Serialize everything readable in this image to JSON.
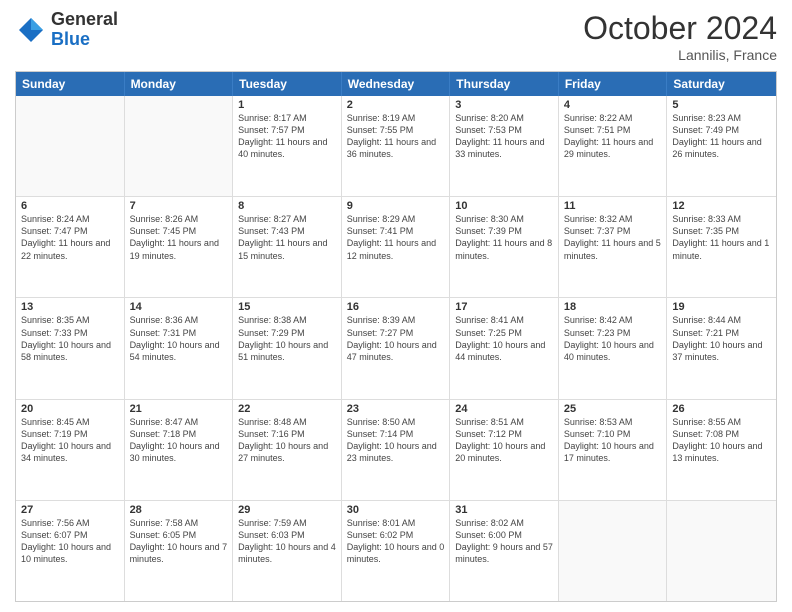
{
  "header": {
    "logo_general": "General",
    "logo_blue": "Blue",
    "month_title": "October 2024",
    "location": "Lannilis, France"
  },
  "days_of_week": [
    "Sunday",
    "Monday",
    "Tuesday",
    "Wednesday",
    "Thursday",
    "Friday",
    "Saturday"
  ],
  "weeks": [
    [
      {
        "day": "",
        "sunrise": "",
        "sunset": "",
        "daylight": "",
        "empty": true
      },
      {
        "day": "",
        "sunrise": "",
        "sunset": "",
        "daylight": "",
        "empty": true
      },
      {
        "day": "1",
        "sunrise": "Sunrise: 8:17 AM",
        "sunset": "Sunset: 7:57 PM",
        "daylight": "Daylight: 11 hours and 40 minutes.",
        "empty": false
      },
      {
        "day": "2",
        "sunrise": "Sunrise: 8:19 AM",
        "sunset": "Sunset: 7:55 PM",
        "daylight": "Daylight: 11 hours and 36 minutes.",
        "empty": false
      },
      {
        "day": "3",
        "sunrise": "Sunrise: 8:20 AM",
        "sunset": "Sunset: 7:53 PM",
        "daylight": "Daylight: 11 hours and 33 minutes.",
        "empty": false
      },
      {
        "day": "4",
        "sunrise": "Sunrise: 8:22 AM",
        "sunset": "Sunset: 7:51 PM",
        "daylight": "Daylight: 11 hours and 29 minutes.",
        "empty": false
      },
      {
        "day": "5",
        "sunrise": "Sunrise: 8:23 AM",
        "sunset": "Sunset: 7:49 PM",
        "daylight": "Daylight: 11 hours and 26 minutes.",
        "empty": false
      }
    ],
    [
      {
        "day": "6",
        "sunrise": "Sunrise: 8:24 AM",
        "sunset": "Sunset: 7:47 PM",
        "daylight": "Daylight: 11 hours and 22 minutes.",
        "empty": false
      },
      {
        "day": "7",
        "sunrise": "Sunrise: 8:26 AM",
        "sunset": "Sunset: 7:45 PM",
        "daylight": "Daylight: 11 hours and 19 minutes.",
        "empty": false
      },
      {
        "day": "8",
        "sunrise": "Sunrise: 8:27 AM",
        "sunset": "Sunset: 7:43 PM",
        "daylight": "Daylight: 11 hours and 15 minutes.",
        "empty": false
      },
      {
        "day": "9",
        "sunrise": "Sunrise: 8:29 AM",
        "sunset": "Sunset: 7:41 PM",
        "daylight": "Daylight: 11 hours and 12 minutes.",
        "empty": false
      },
      {
        "day": "10",
        "sunrise": "Sunrise: 8:30 AM",
        "sunset": "Sunset: 7:39 PM",
        "daylight": "Daylight: 11 hours and 8 minutes.",
        "empty": false
      },
      {
        "day": "11",
        "sunrise": "Sunrise: 8:32 AM",
        "sunset": "Sunset: 7:37 PM",
        "daylight": "Daylight: 11 hours and 5 minutes.",
        "empty": false
      },
      {
        "day": "12",
        "sunrise": "Sunrise: 8:33 AM",
        "sunset": "Sunset: 7:35 PM",
        "daylight": "Daylight: 11 hours and 1 minute.",
        "empty": false
      }
    ],
    [
      {
        "day": "13",
        "sunrise": "Sunrise: 8:35 AM",
        "sunset": "Sunset: 7:33 PM",
        "daylight": "Daylight: 10 hours and 58 minutes.",
        "empty": false
      },
      {
        "day": "14",
        "sunrise": "Sunrise: 8:36 AM",
        "sunset": "Sunset: 7:31 PM",
        "daylight": "Daylight: 10 hours and 54 minutes.",
        "empty": false
      },
      {
        "day": "15",
        "sunrise": "Sunrise: 8:38 AM",
        "sunset": "Sunset: 7:29 PM",
        "daylight": "Daylight: 10 hours and 51 minutes.",
        "empty": false
      },
      {
        "day": "16",
        "sunrise": "Sunrise: 8:39 AM",
        "sunset": "Sunset: 7:27 PM",
        "daylight": "Daylight: 10 hours and 47 minutes.",
        "empty": false
      },
      {
        "day": "17",
        "sunrise": "Sunrise: 8:41 AM",
        "sunset": "Sunset: 7:25 PM",
        "daylight": "Daylight: 10 hours and 44 minutes.",
        "empty": false
      },
      {
        "day": "18",
        "sunrise": "Sunrise: 8:42 AM",
        "sunset": "Sunset: 7:23 PM",
        "daylight": "Daylight: 10 hours and 40 minutes.",
        "empty": false
      },
      {
        "day": "19",
        "sunrise": "Sunrise: 8:44 AM",
        "sunset": "Sunset: 7:21 PM",
        "daylight": "Daylight: 10 hours and 37 minutes.",
        "empty": false
      }
    ],
    [
      {
        "day": "20",
        "sunrise": "Sunrise: 8:45 AM",
        "sunset": "Sunset: 7:19 PM",
        "daylight": "Daylight: 10 hours and 34 minutes.",
        "empty": false
      },
      {
        "day": "21",
        "sunrise": "Sunrise: 8:47 AM",
        "sunset": "Sunset: 7:18 PM",
        "daylight": "Daylight: 10 hours and 30 minutes.",
        "empty": false
      },
      {
        "day": "22",
        "sunrise": "Sunrise: 8:48 AM",
        "sunset": "Sunset: 7:16 PM",
        "daylight": "Daylight: 10 hours and 27 minutes.",
        "empty": false
      },
      {
        "day": "23",
        "sunrise": "Sunrise: 8:50 AM",
        "sunset": "Sunset: 7:14 PM",
        "daylight": "Daylight: 10 hours and 23 minutes.",
        "empty": false
      },
      {
        "day": "24",
        "sunrise": "Sunrise: 8:51 AM",
        "sunset": "Sunset: 7:12 PM",
        "daylight": "Daylight: 10 hours and 20 minutes.",
        "empty": false
      },
      {
        "day": "25",
        "sunrise": "Sunrise: 8:53 AM",
        "sunset": "Sunset: 7:10 PM",
        "daylight": "Daylight: 10 hours and 17 minutes.",
        "empty": false
      },
      {
        "day": "26",
        "sunrise": "Sunrise: 8:55 AM",
        "sunset": "Sunset: 7:08 PM",
        "daylight": "Daylight: 10 hours and 13 minutes.",
        "empty": false
      }
    ],
    [
      {
        "day": "27",
        "sunrise": "Sunrise: 7:56 AM",
        "sunset": "Sunset: 6:07 PM",
        "daylight": "Daylight: 10 hours and 10 minutes.",
        "empty": false
      },
      {
        "day": "28",
        "sunrise": "Sunrise: 7:58 AM",
        "sunset": "Sunset: 6:05 PM",
        "daylight": "Daylight: 10 hours and 7 minutes.",
        "empty": false
      },
      {
        "day": "29",
        "sunrise": "Sunrise: 7:59 AM",
        "sunset": "Sunset: 6:03 PM",
        "daylight": "Daylight: 10 hours and 4 minutes.",
        "empty": false
      },
      {
        "day": "30",
        "sunrise": "Sunrise: 8:01 AM",
        "sunset": "Sunset: 6:02 PM",
        "daylight": "Daylight: 10 hours and 0 minutes.",
        "empty": false
      },
      {
        "day": "31",
        "sunrise": "Sunrise: 8:02 AM",
        "sunset": "Sunset: 6:00 PM",
        "daylight": "Daylight: 9 hours and 57 minutes.",
        "empty": false
      },
      {
        "day": "",
        "sunrise": "",
        "sunset": "",
        "daylight": "",
        "empty": true
      },
      {
        "day": "",
        "sunrise": "",
        "sunset": "",
        "daylight": "",
        "empty": true
      }
    ]
  ]
}
